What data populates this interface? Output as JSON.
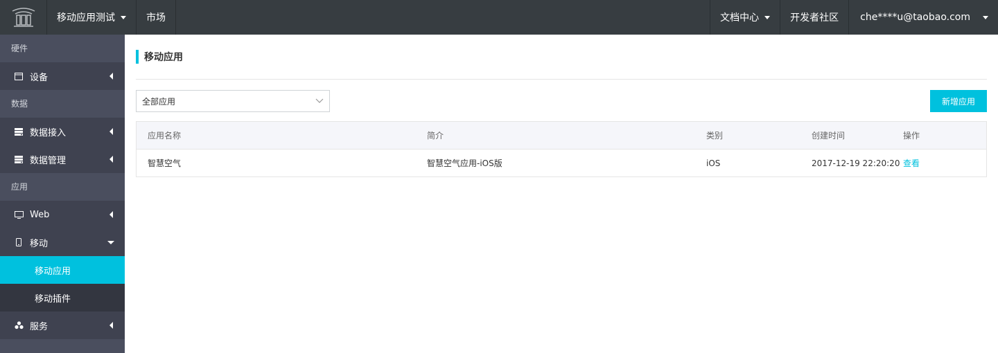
{
  "topbar": {
    "product": "移动应用测试",
    "market": "市场",
    "docs": "文档中心",
    "community": "开发者社区",
    "user": "che****u@taobao.com"
  },
  "sidebar": {
    "sections": [
      "硬件",
      "数据",
      "应用"
    ],
    "items": {
      "device": "设备",
      "data_access": "数据接入",
      "data_manage": "数据管理",
      "web": "Web",
      "mobile": "移动",
      "mobile_app": "移动应用",
      "mobile_plugin": "移动插件",
      "service": "服务"
    }
  },
  "main": {
    "title": "移动应用",
    "filter_value": "全部应用",
    "add_button": "新增应用",
    "columns": [
      "应用名称",
      "简介",
      "类别",
      "创建时间",
      "操作"
    ],
    "rows": [
      {
        "name": "智慧空气",
        "desc": "智慧空气应用-iOS版",
        "category": "iOS",
        "created": "2017-12-19 22:20:20",
        "action": "查看"
      }
    ]
  },
  "colors": {
    "accent": "#00c1de",
    "topbar": "#373d41",
    "sidebar": "#4a4e5e"
  }
}
